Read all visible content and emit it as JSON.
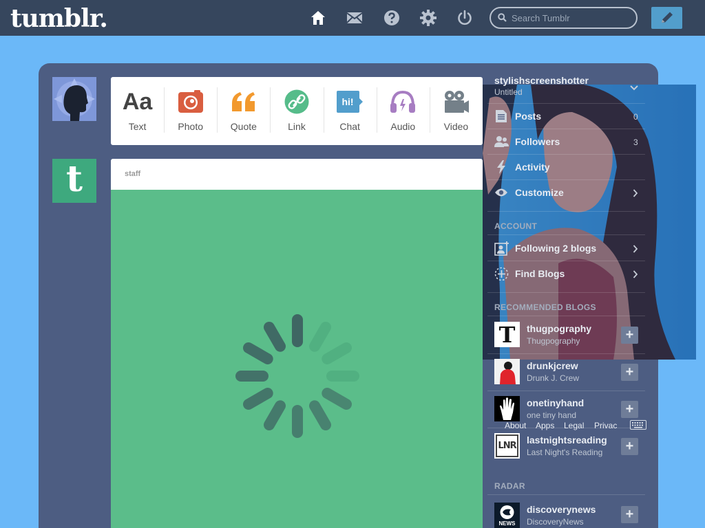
{
  "header": {
    "logo": "tumblr.",
    "search_placeholder": "Search Tumblr",
    "nav_icons": [
      "home-icon",
      "mail-icon",
      "help-icon",
      "settings-icon",
      "power-icon"
    ]
  },
  "post_types": [
    {
      "label": "Text",
      "icon": "text-post-icon",
      "color": "#444444"
    },
    {
      "label": "Photo",
      "icon": "camera-icon",
      "color": "#d95e40"
    },
    {
      "label": "Quote",
      "icon": "quote-icon",
      "color": "#f2992e"
    },
    {
      "label": "Link",
      "icon": "link-icon",
      "color": "#56bc8a"
    },
    {
      "label": "Chat",
      "icon": "chat-icon",
      "color": "#529ecc"
    },
    {
      "label": "Audio",
      "icon": "headphones-icon",
      "color": "#a77dc2"
    },
    {
      "label": "Video",
      "icon": "video-camera-icon",
      "color": "#748089"
    }
  ],
  "text_icon_glyph": "Aa",
  "chat_icon_glyph": "hi!",
  "staff_avatar_glyph": "t",
  "post": {
    "blog_name": "staff"
  },
  "sidebar": {
    "blog_name": "stylishscreenshotter",
    "blog_title": "Untitled",
    "menu": [
      {
        "label": "Posts",
        "count": "0"
      },
      {
        "label": "Followers",
        "count": "3"
      },
      {
        "label": "Activity"
      },
      {
        "label": "Customize"
      }
    ],
    "account_heading": "ACCOUNT",
    "account_items": [
      {
        "label": "Following 2 blogs"
      },
      {
        "label": "Find Blogs"
      }
    ],
    "recommended_heading": "RECOMMENDED BLOGS",
    "recommended": [
      {
        "name": "thugpography",
        "title": "Thugpography",
        "avatar_glyph": "T"
      },
      {
        "name": "drunkjcrew",
        "title": "Drunk J. Crew"
      },
      {
        "name": "onetinyhand",
        "title": "one tiny hand"
      },
      {
        "name": "lastnightsreading",
        "title": "Last Night's Reading",
        "avatar_glyph": "LNR"
      }
    ],
    "follow_label": "+",
    "radar_heading": "RADAR",
    "radar": [
      {
        "name": "discoverynews",
        "title": "DiscoveryNews",
        "avatar_glyph": "NEWS"
      }
    ],
    "footer_links": [
      "About",
      "Apps",
      "Legal",
      "Privac"
    ]
  },
  "colors": {
    "topbar": "#36465d",
    "background": "#6bb8f8",
    "panel": "#4d5d82",
    "post_body": "#5bbd8a",
    "compose": "#529ecc"
  }
}
